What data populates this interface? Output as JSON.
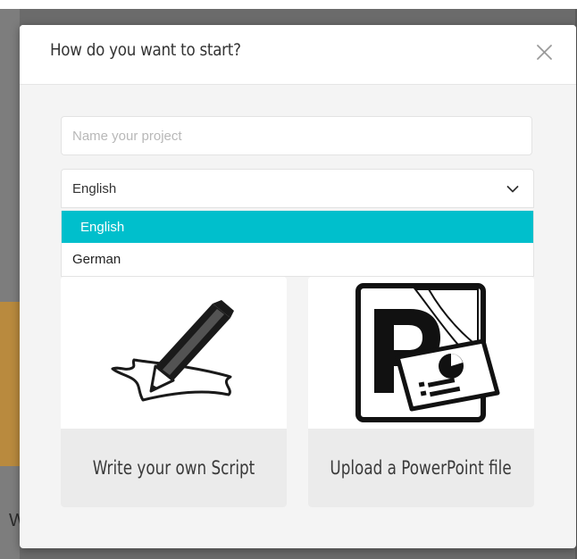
{
  "dialog": {
    "title": "How do you want to start?",
    "close_icon": "close-icon"
  },
  "project_name": {
    "value": "",
    "placeholder": "Name your project"
  },
  "language_select": {
    "selected": "English",
    "options": [
      {
        "label": "English",
        "selected": true
      },
      {
        "label": "German",
        "selected": false
      }
    ]
  },
  "options": [
    {
      "label": "Write your own Script",
      "icon": "pencil-paper-icon"
    },
    {
      "label": "Upload a PowerPoint file",
      "icon": "powerpoint-icon"
    }
  ],
  "colors": {
    "accent": "#00bfcc",
    "card_footer": "#ebebeb",
    "dialog_bg": "#f4f4f4"
  }
}
